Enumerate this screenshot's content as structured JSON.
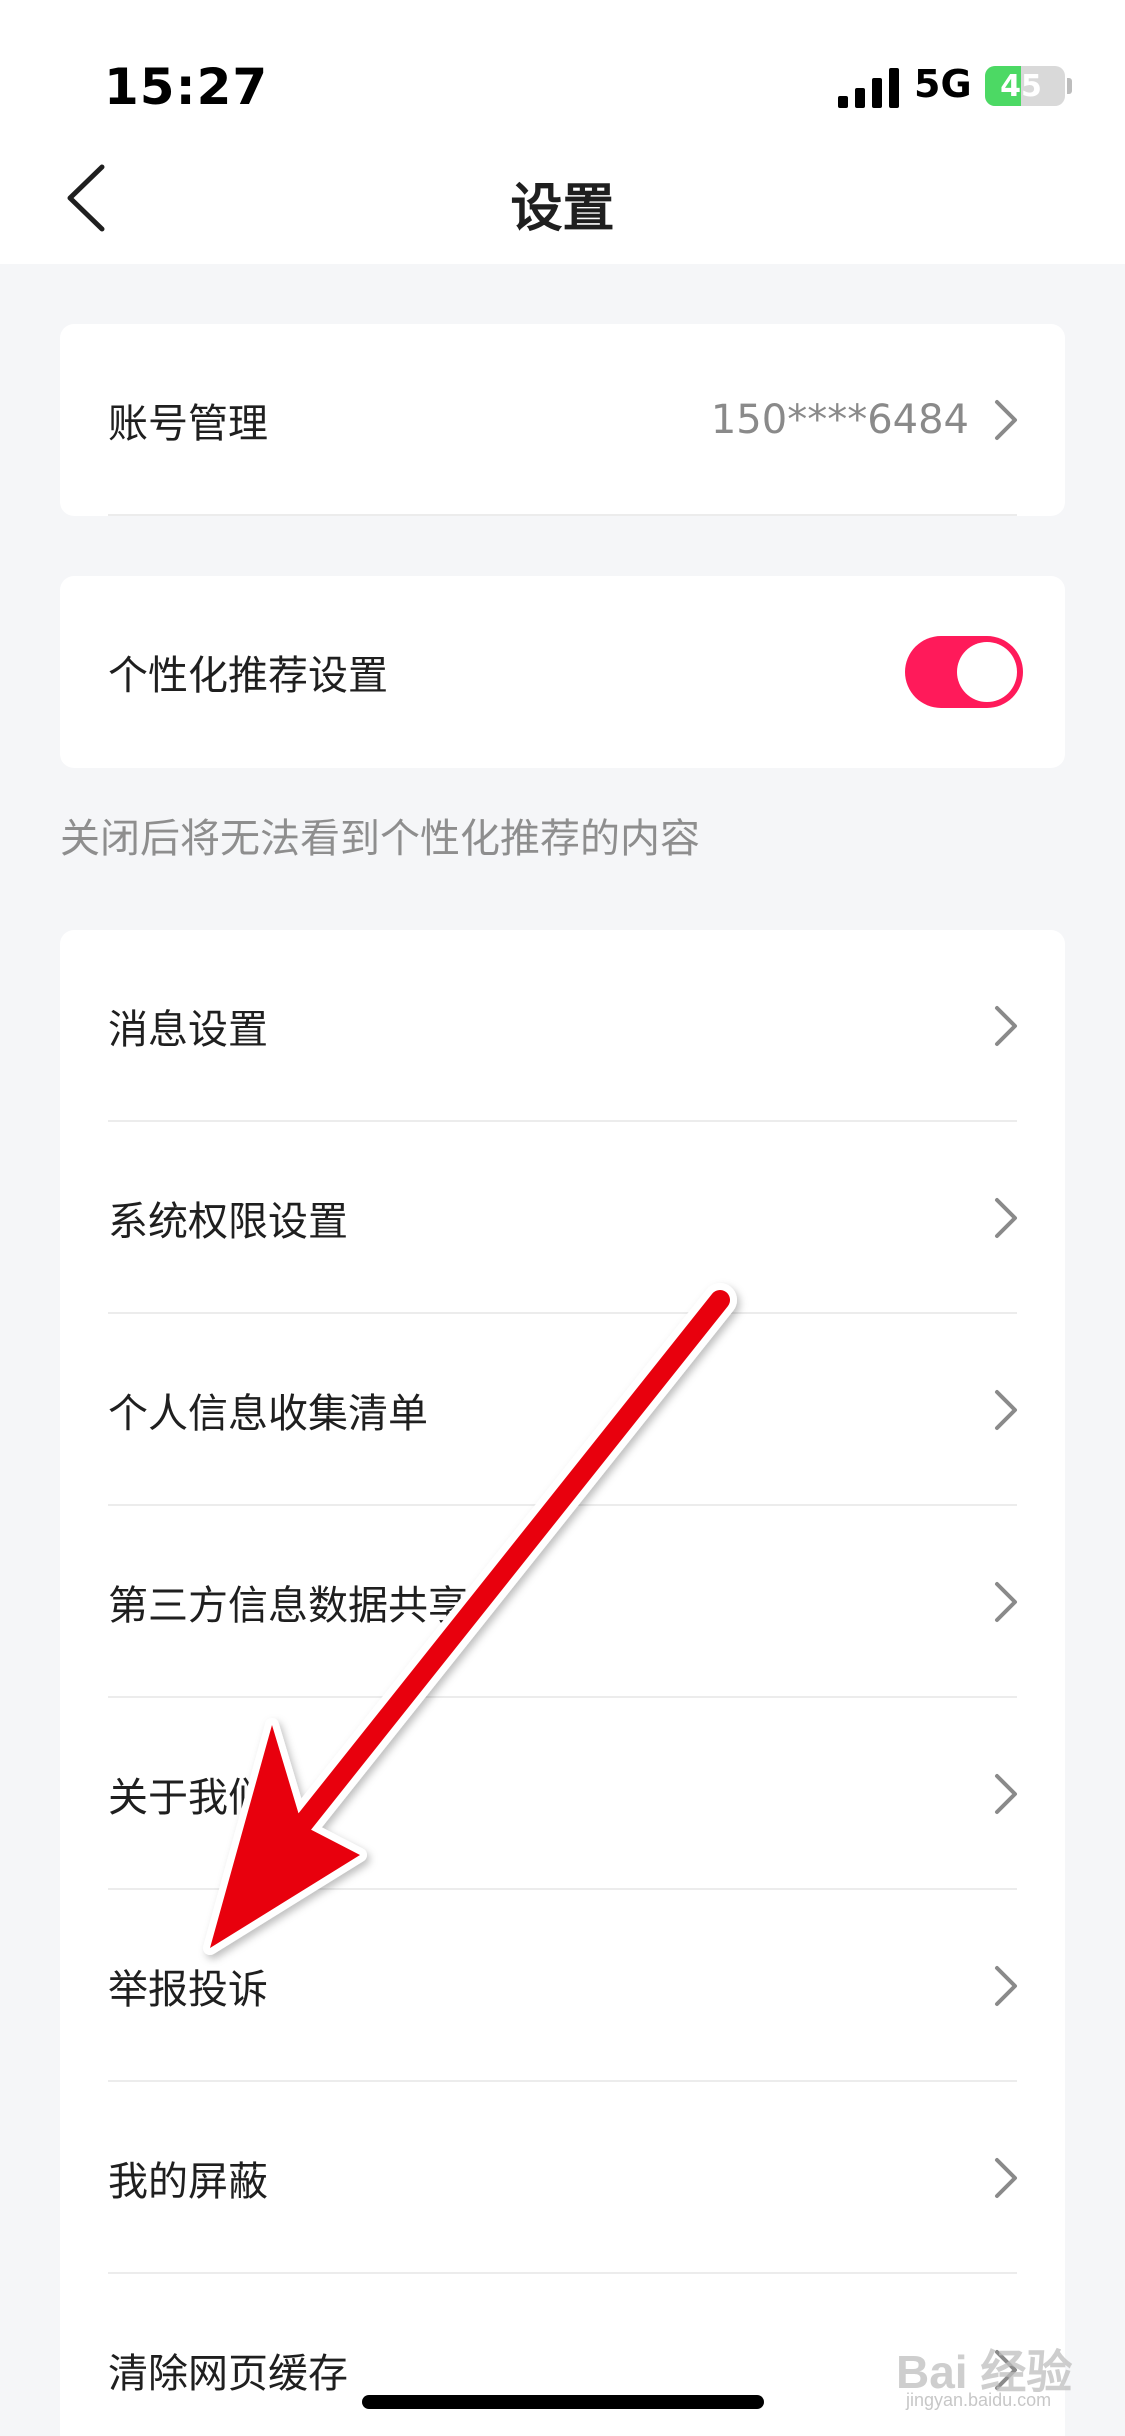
{
  "status_bar": {
    "time": "15:27",
    "network": "5G",
    "battery_level": "45",
    "battery_fraction": 0.45
  },
  "nav": {
    "title": "设置",
    "back_icon": "chevron-left-icon"
  },
  "account": {
    "label": "账号管理",
    "value": "150****6484"
  },
  "personalization": {
    "label": "个性化推荐设置",
    "enabled": true,
    "toggle_color": "#ff1a5a",
    "hint": "关闭后将无法看到个性化推荐的内容"
  },
  "menu": {
    "items": [
      {
        "label": "消息设置"
      },
      {
        "label": "系统权限设置"
      },
      {
        "label": "个人信息收集清单"
      },
      {
        "label": "第三方信息数据共享"
      },
      {
        "label": "关于我们"
      },
      {
        "label": "举报投诉"
      },
      {
        "label": "我的屏蔽"
      },
      {
        "label": "清除网页缓存"
      }
    ]
  },
  "annotation": {
    "arrow_color": "#e8000b"
  },
  "watermark": {
    "text": "Bai 经验",
    "sub": "jingyan.baidu.com"
  }
}
